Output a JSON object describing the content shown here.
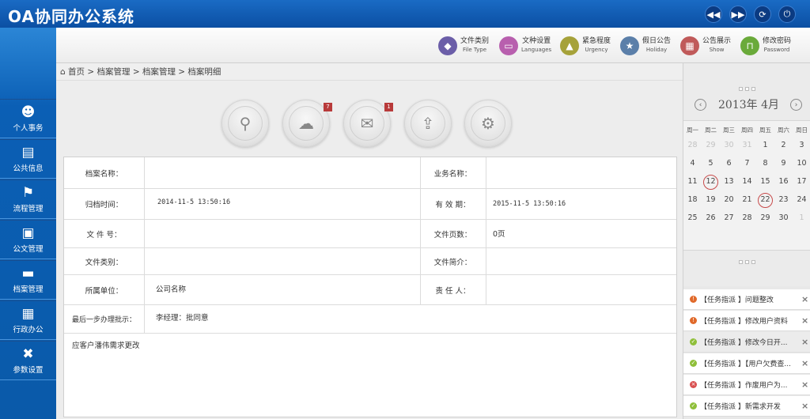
{
  "app": {
    "title": "OA协同办公系统"
  },
  "window_controls": [
    {
      "name": "back-button",
      "icon": "rewind-icon",
      "glyph": "◀◀"
    },
    {
      "name": "forward-button",
      "icon": "fast-forward-icon",
      "glyph": "▶▶"
    },
    {
      "name": "refresh-button",
      "icon": "refresh-icon",
      "glyph": "⟳"
    },
    {
      "name": "power-button",
      "icon": "power-icon",
      "glyph": "⏻"
    }
  ],
  "sidebar": {
    "items": [
      {
        "label": "个人事务",
        "icon": "person-icon",
        "glyph": "☻"
      },
      {
        "label": "公共信息",
        "icon": "document-icon",
        "glyph": "▤"
      },
      {
        "label": "流程管理",
        "icon": "flag-icon",
        "glyph": "⚑"
      },
      {
        "label": "公文管理",
        "icon": "briefcase-icon",
        "glyph": "▣"
      },
      {
        "label": "档案管理",
        "icon": "folder-icon",
        "glyph": "▬"
      },
      {
        "label": "行政办公",
        "icon": "building-icon",
        "glyph": "▦"
      },
      {
        "label": "参数设置",
        "icon": "tools-icon",
        "glyph": "✖"
      }
    ]
  },
  "toolbar": {
    "items": [
      {
        "zh": "文件类别",
        "en": "File Type",
        "icon": "tag-icon",
        "color": "#6b5ea8",
        "glyph": "◆"
      },
      {
        "zh": "文种设置",
        "en": "Languages",
        "icon": "picture-icon",
        "color": "#b85fae",
        "glyph": "▭"
      },
      {
        "zh": "紧急程度",
        "en": "Urgency",
        "icon": "warning-icon",
        "color": "#a6a23a",
        "glyph": "▲"
      },
      {
        "zh": "假日公告",
        "en": "Holiday",
        "icon": "star-icon",
        "color": "#5b7fa9",
        "glyph": "★"
      },
      {
        "zh": "公告展示",
        "en": "Show",
        "icon": "board-icon",
        "color": "#c05a5a",
        "glyph": "▦"
      },
      {
        "zh": "修改密码",
        "en": "Password",
        "icon": "lock-icon",
        "color": "#6aaa3a",
        "glyph": "⊓"
      }
    ]
  },
  "breadcrumb": {
    "text": "首页 > 档案管理 > 档案管理 > 档案明细"
  },
  "action_icons": [
    {
      "name": "search",
      "icon": "magnifier-icon",
      "glyph": "⚲",
      "badge": ""
    },
    {
      "name": "messages",
      "icon": "chat-icon",
      "glyph": "☁",
      "badge": "7"
    },
    {
      "name": "mail",
      "icon": "envelope-icon",
      "glyph": "✉",
      "badge": "1"
    },
    {
      "name": "inbox",
      "icon": "inbox-icon",
      "glyph": "⇪",
      "badge": ""
    },
    {
      "name": "settings",
      "icon": "gear-icon",
      "glyph": "⚙",
      "badge": ""
    }
  ],
  "form": {
    "archive_name_label": "档案名称：",
    "archive_name_value": "",
    "business_name_label": "业务名称：",
    "business_name_value": "",
    "archive_time_label": "归档时间：",
    "archive_time_value": "2014-11-5 13:50:16",
    "valid_period_label": "有 效 期：",
    "valid_period_value": "2015-11-5 13:50:16",
    "file_no_label": "文 件 号：",
    "file_no_value": "",
    "file_pages_label": "文件页数：",
    "file_pages_value": "0页",
    "file_type_label": "文件类别：",
    "file_type_value": "",
    "file_intro_label": "文件简介：",
    "file_intro_value": "",
    "unit_label": "所属单位：",
    "unit_value": "公司名称",
    "owner_label": "责 任 人：",
    "owner_value": "",
    "last_step_label": "最后一步办理批示：",
    "last_step_value": "李经理：批同意",
    "memo": "应客户潘伟需求更改"
  },
  "calendar": {
    "prev": "‹",
    "next": "›",
    "title": "2013年   4月",
    "weekdays": [
      "周一",
      "周二",
      "周三",
      "周四",
      "周五",
      "周六",
      "周日"
    ],
    "weeks": [
      [
        "28",
        "29",
        "30",
        "31",
        "1",
        "2",
        "3"
      ],
      [
        "4",
        "5",
        "6",
        "7",
        "8",
        "9",
        "10"
      ],
      [
        "11",
        "12",
        "13",
        "14",
        "15",
        "16",
        "17"
      ],
      [
        "18",
        "19",
        "20",
        "21",
        "22",
        "23",
        "24"
      ],
      [
        "25",
        "26",
        "27",
        "28",
        "29",
        "30",
        "1"
      ]
    ],
    "muted": [
      [
        0,
        0
      ],
      [
        0,
        1
      ],
      [
        0,
        2
      ],
      [
        0,
        3
      ],
      [
        4,
        6
      ]
    ],
    "circled": [
      [
        2,
        1
      ],
      [
        3,
        4
      ]
    ]
  },
  "tasks": [
    {
      "text": "【任务指派 】问题整改",
      "status": "warning",
      "color": "#e0692a"
    },
    {
      "text": "【任务指派 】修改用户资料",
      "status": "warning",
      "color": "#e0692a"
    },
    {
      "text": "【任务指派 】修改今日开...",
      "status": "done",
      "color": "#8fbf3a"
    },
    {
      "text": "【任务指派 】【用户欠费查...",
      "status": "done",
      "color": "#8fbf3a"
    },
    {
      "text": "【任务指派 】作废用户为...",
      "status": "error",
      "color": "#d95050"
    },
    {
      "text": "【任务指派 】新需求开发",
      "status": "done",
      "color": "#8fbf3a"
    }
  ]
}
